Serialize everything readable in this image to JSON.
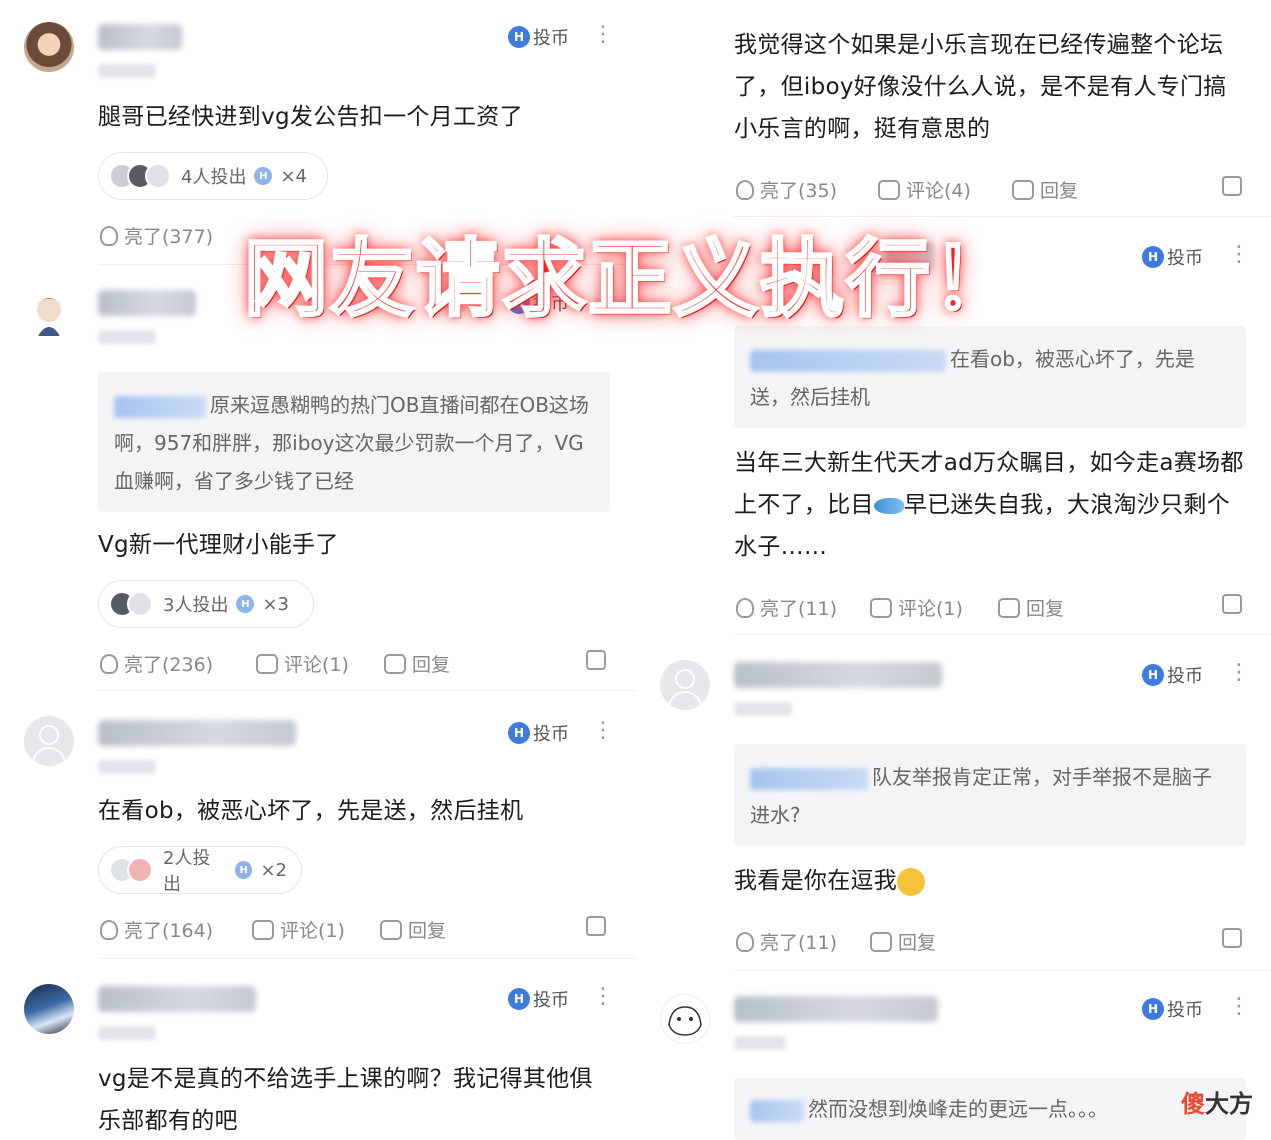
{
  "common": {
    "coin_label": "投币",
    "more_glyph": "⋮",
    "coin_glyph": "H",
    "reply_label": "回复"
  },
  "left": {
    "c1": {
      "text": "腿哥已经快进到vg发公告扣一个月工资了",
      "donors": "4人投出",
      "multiplier": "×4",
      "likes": "亮了(377)"
    },
    "c2": {
      "quote": "原来逗愚糊鸭的热门OB直播间都在OB这场啊，957和胖胖，那iboy这次最少罚款一个月了，VG血赚啊，省了多少钱了已经",
      "text": "Vg新一代理财小能手了",
      "donors": "3人投出",
      "multiplier": "×3",
      "likes": "亮了(236)",
      "comments": "评论(1)"
    },
    "c3": {
      "text": "在看ob，被恶心坏了，先是送，然后挂机",
      "donors": "2人投出",
      "multiplier": "×2",
      "likes": "亮了(164)",
      "comments": "评论(1)"
    },
    "c4": {
      "text": "vg是不是真的不给选手上课的啊？我记得其他俱乐部都有的吧"
    }
  },
  "right": {
    "c1": {
      "text": "我觉得这个如果是小乐言现在已经传遍整个论坛了，但iboy好像没什么人说，是不是有人专门搞小乐言的啊，挺有意思的",
      "likes": "亮了(35)",
      "comments": "评论(4)"
    },
    "c2": {
      "quote": "在看ob，被恶心坏了，先是送，然后挂机",
      "text_part1": "当年三大新生代天才ad万众瞩目，如今走a赛场都上不了，比目",
      "text_part2": "早已迷失自我，大浪淘沙只剩个水子……",
      "likes": "亮了(11)",
      "comments": "评论(1)"
    },
    "c3": {
      "quote": "队友举报肯定正常，对手举报不是脑子进水?",
      "text": "我看是你在逗我",
      "likes": "亮了(11)"
    },
    "c4": {
      "quote": "然而没想到焕峰走的更远一点。。。"
    }
  },
  "overlay": {
    "banner": "网友请求正义执行！",
    "watermark_a": "傻",
    "watermark_b": "大方"
  },
  "icons": {
    "like": "bulb-icon",
    "comment": "comment-icon",
    "reply": "reply-icon",
    "share": "share-icon",
    "coin": "coin-icon",
    "more": "more-vertical-icon"
  },
  "colors": {
    "coin_blue": "#3e7be0",
    "banner_red": "#ff1e1e",
    "quote_bg": "#f3f4f6"
  }
}
